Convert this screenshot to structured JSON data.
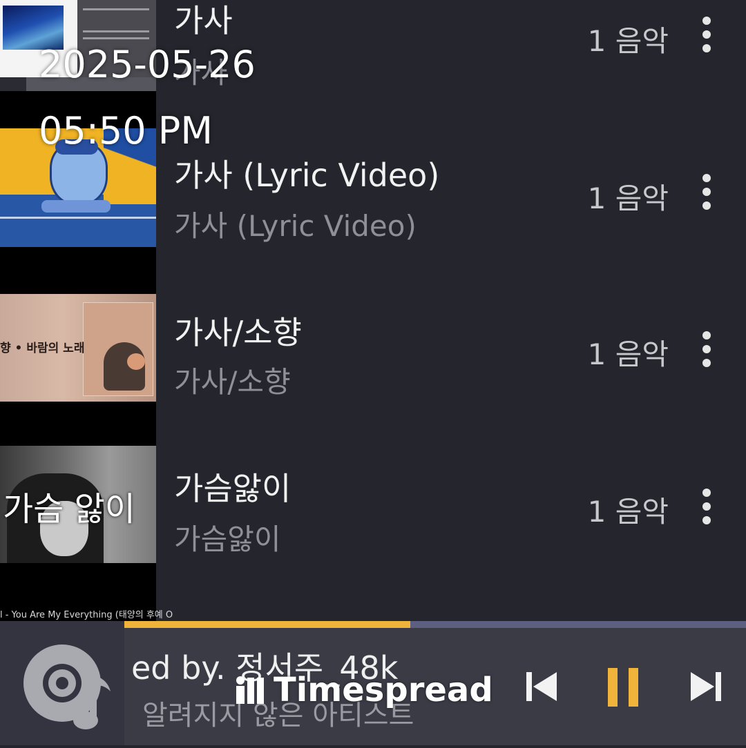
{
  "overlay": {
    "date": "2025-05-26",
    "time": "05:50 PM"
  },
  "tracks": [
    {
      "title": "가사",
      "subtitle": "가사",
      "count": "1 음악"
    },
    {
      "title": "가사 (Lyric Video)",
      "subtitle": "가사 (Lyric Video)",
      "count": "1 음악"
    },
    {
      "title": "가사/소향",
      "subtitle": "가사/소향",
      "count": "1 음악"
    },
    {
      "title": "가슴앓이",
      "subtitle": "가슴앓이",
      "count": "1 음악"
    }
  ],
  "thumbnails": {
    "card": "가슴 앓이",
    "caption": "l - You Are My Everything (태양의 후예 O",
    "cover_text": "향 • 바람의 노래"
  },
  "player": {
    "title": "ed by. 정서주_48k",
    "artist": "알려지지 않은 아티스트",
    "progress_percent": 46,
    "accent_color": "#f0b43a",
    "track_color": "#5c5f80",
    "icons": [
      "music-disc-icon",
      "skip-previous-icon",
      "pause-icon",
      "skip-next-icon"
    ]
  },
  "watermark": {
    "text": "Timespread"
  }
}
